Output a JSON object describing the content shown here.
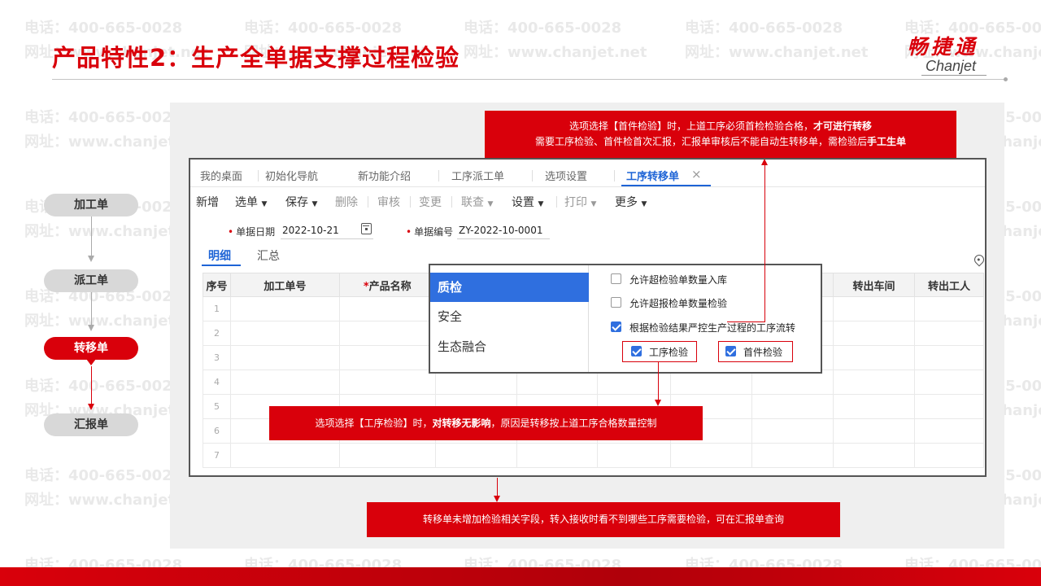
{
  "slide": {
    "title": "产品特性2：生产全单据支撑过程检验",
    "logo_cn": "畅捷通",
    "logo_en": "Chanjet"
  },
  "watermark": {
    "phone": "电话：400-665-0028",
    "site": "网址：www.chanjet.net"
  },
  "flow": {
    "nodes": [
      {
        "label": "加工单",
        "active": false
      },
      {
        "label": "派工单",
        "active": false
      },
      {
        "label": "转移单",
        "active": true
      },
      {
        "label": "汇报单",
        "active": false
      }
    ]
  },
  "app": {
    "tabs": [
      "我的桌面",
      "初始化导航",
      "新功能介绍",
      "工序派工单",
      "选项设置",
      "工序转移单"
    ],
    "active_tab": "工序转移单",
    "close_icon": "×",
    "toolbar": {
      "new": "新增",
      "select": "选单",
      "save": "保存",
      "delete": "删除",
      "audit": "审核",
      "change": "变更",
      "query": "联查",
      "settings": "设置",
      "print": "打印",
      "more": "更多"
    },
    "form": {
      "date_label": "单据日期",
      "date_value": "2022-10-21",
      "code_label": "单据编号",
      "code_value": "ZY-2022-10-0001"
    },
    "sub_tabs": [
      "明细",
      "汇总"
    ],
    "table": {
      "headers": [
        "序号",
        "加工单号",
        "产品名称",
        "",
        "",
        "",
        "",
        "",
        "转出车间",
        "转出工人"
      ],
      "rows": [
        "1",
        "2",
        "3",
        "4",
        "5",
        "6",
        "7"
      ]
    }
  },
  "popup": {
    "menu": [
      "质检",
      "安全",
      "生态融合"
    ],
    "active_menu": "质检",
    "options": [
      {
        "label": "允许超检验单数量入库",
        "checked": false
      },
      {
        "label": "允许超报检单数量检验",
        "checked": false
      },
      {
        "label": "根据检验结果严控生产过程的工序流转",
        "checked": true
      }
    ],
    "sub_options": [
      {
        "label": "工序检验",
        "checked": true
      },
      {
        "label": "首件检验",
        "checked": true
      }
    ]
  },
  "callouts": {
    "top_line1_a": "选项选择【首件检验】时，上道工序必须首检检验合格，",
    "top_line1_b": "才可进行转移",
    "top_line2_a": "需要工序检验、首件检首次汇报，汇报单审核后不能自动生转移单，需检验后",
    "top_line2_b": "手工生单",
    "mid_a": "选项选择【工序检验】时，",
    "mid_b": "对转移无影响",
    "mid_c": "，原因是转移按上道工序合格数量控制",
    "bottom": "转移单未增加检验相关字段，转入接收时看不到哪些工序需要检验，可在汇报单查询"
  },
  "colors": {
    "brand_red": "#d9000b",
    "accent_blue": "#1e64d6",
    "panel_grey": "#efefef"
  }
}
